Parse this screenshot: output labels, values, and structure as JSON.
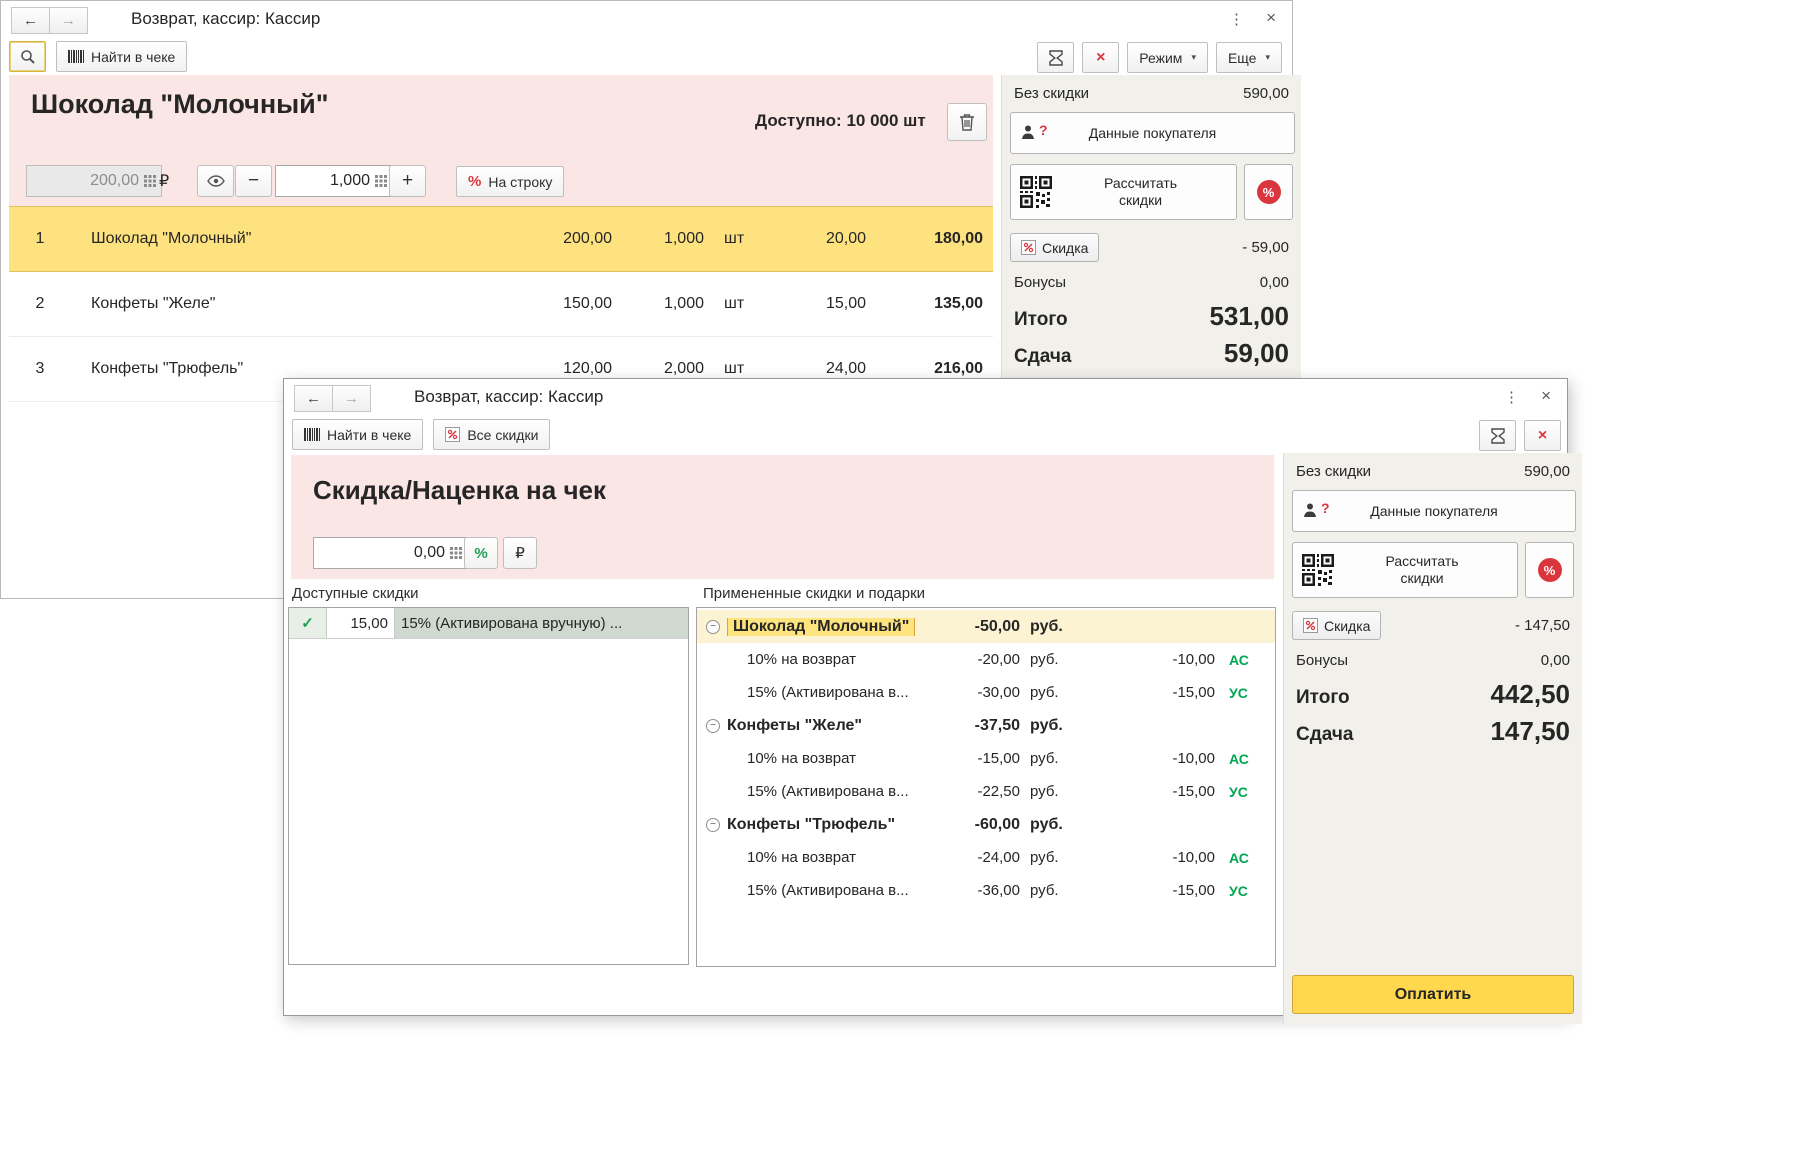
{
  "icons": {
    "back_arrow": "←",
    "forward_arrow": "→",
    "menu_dots": "⋮",
    "close": "×",
    "percent": "%",
    "ruble": "₽",
    "check": "✓",
    "minus": "−",
    "plus": "+",
    "caret": "▾",
    "question": "?"
  },
  "back_window": {
    "title": "Возврат, кассир: Кассир",
    "toolbar": {
      "find_in_check": "Найти в чеке",
      "mode": "Режим",
      "more": "Еще"
    },
    "product": {
      "name": "Шоколад \"Молочный\"",
      "available": "Доступно: 10 000 шт",
      "price": "200,00",
      "quantity": "1,000",
      "per_line": "На строку"
    },
    "receipt_rows": [
      {
        "num": "1",
        "name": "Шоколад \"Молочный\"",
        "price": "200,00",
        "qty": "1,000",
        "unit": "шт",
        "discount": "20,00",
        "total": "180,00"
      },
      {
        "num": "2",
        "name": "Конфеты \"Желе\"",
        "price": "150,00",
        "qty": "1,000",
        "unit": "шт",
        "discount": "15,00",
        "total": "135,00"
      },
      {
        "num": "3",
        "name": "Конфеты \"Трюфель\"",
        "price": "120,00",
        "qty": "2,000",
        "unit": "шт",
        "discount": "24,00",
        "total": "216,00"
      }
    ],
    "summary": {
      "no_discount_label": "Без скидки",
      "no_discount_value": "590,00",
      "customer_button": "Данные покупателя",
      "calc_button": "Рассчитать скидки",
      "discount_button": "Скидка",
      "discount_value": "- 59,00",
      "bonus_label": "Бонусы",
      "bonus_value": "0,00",
      "total_label": "Итого",
      "total_value": "531,00",
      "change_label": "Сдача",
      "change_value": "59,00"
    }
  },
  "front_window": {
    "title": "Возврат, кассир: Кассир",
    "toolbar": {
      "find_in_check": "Найти в чеке",
      "all_discounts": "Все скидки"
    },
    "header": {
      "title": "Скидка/Наценка на чек",
      "amount": "0,00"
    },
    "available_discounts": {
      "label": "Доступные скидки",
      "rows": [
        {
          "value": "15,00",
          "name": "15% (Активирована вручную) ..."
        }
      ]
    },
    "applied_discounts": {
      "label": "Примененные скидки и подарки",
      "groups": [
        {
          "name": "Шоколад \"Молочный\"",
          "amount": "-50,00",
          "unit": "руб.",
          "items": [
            {
              "name": "10% на возврат",
              "amount": "-20,00",
              "unit": "руб.",
              "percent": "-10,00",
              "tag": "АС"
            },
            {
              "name": "15% (Активирована в...",
              "amount": "-30,00",
              "unit": "руб.",
              "percent": "-15,00",
              "tag": "УС"
            }
          ]
        },
        {
          "name": "Конфеты \"Желе\"",
          "amount": "-37,50",
          "unit": "руб.",
          "items": [
            {
              "name": "10% на возврат",
              "amount": "-15,00",
              "unit": "руб.",
              "percent": "-10,00",
              "tag": "АС"
            },
            {
              "name": "15% (Активирована в...",
              "amount": "-22,50",
              "unit": "руб.",
              "percent": "-15,00",
              "tag": "УС"
            }
          ]
        },
        {
          "name": "Конфеты \"Трюфель\"",
          "amount": "-60,00",
          "unit": "руб.",
          "items": [
            {
              "name": "10% на возврат",
              "amount": "-24,00",
              "unit": "руб.",
              "percent": "-10,00",
              "tag": "АС"
            },
            {
              "name": "15% (Активирована в...",
              "amount": "-36,00",
              "unit": "руб.",
              "percent": "-15,00",
              "tag": "УС"
            }
          ]
        }
      ]
    },
    "summary": {
      "no_discount_label": "Без скидки",
      "no_discount_value": "590,00",
      "customer_button": "Данные покупателя",
      "calc_button": "Рассчитать скидки",
      "discount_button": "Скидка",
      "discount_value": "- 147,50",
      "bonus_label": "Бонусы",
      "bonus_value": "0,00",
      "total_label": "Итого",
      "total_value": "442,50",
      "change_label": "Сдача",
      "change_value": "147,50",
      "pay_button": "Оплатить"
    }
  }
}
